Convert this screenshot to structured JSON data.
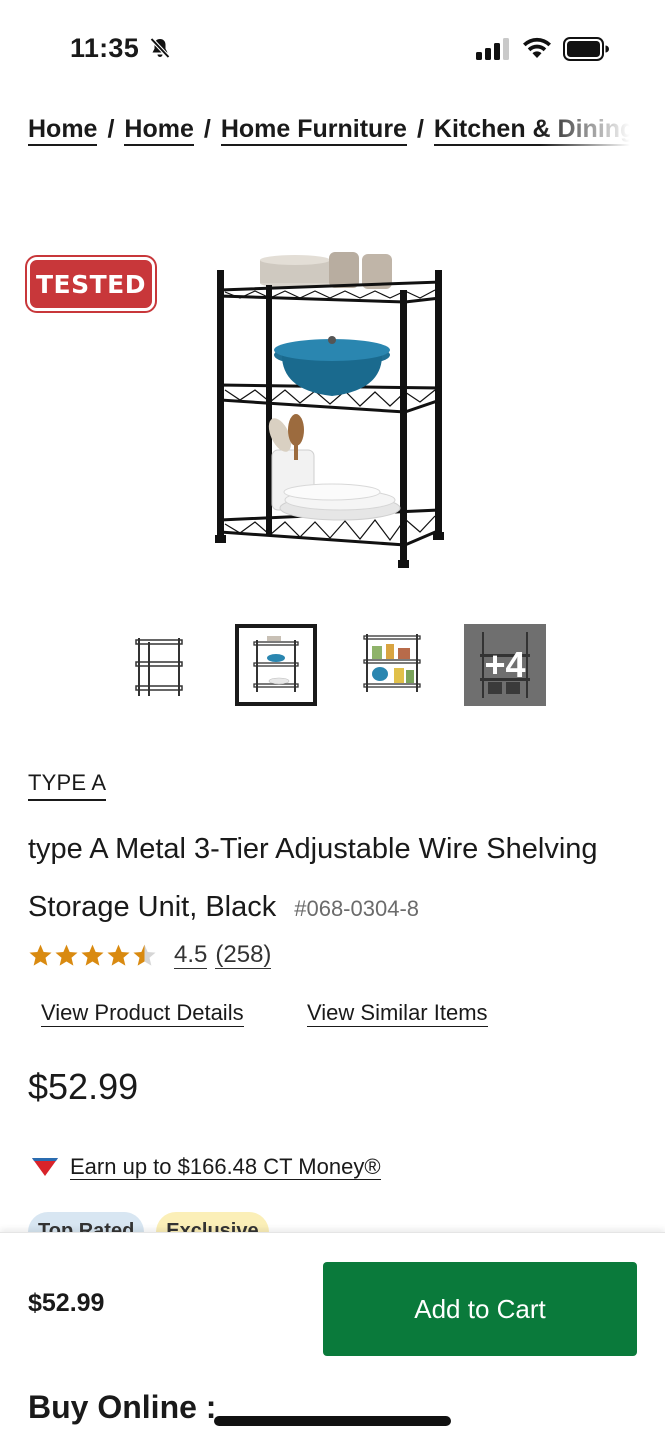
{
  "status_bar": {
    "time": "11:35"
  },
  "breadcrumb": {
    "items": [
      "Home",
      "Home",
      "Home Furniture",
      "Kitchen & Dining"
    ],
    "separator": "/"
  },
  "badge": {
    "tested_label": "TESTED"
  },
  "gallery": {
    "more_label": "+4"
  },
  "product": {
    "brand": "TYPE A",
    "title": "type A Metal 3-Tier Adjustable Wire Shelving Storage Unit, Black",
    "sku": "#068-0304-8",
    "rating_value": "4.5",
    "rating_count": "(258)",
    "rating_stars": 4.5,
    "price": "$52.99"
  },
  "links": {
    "details": "View Product Details",
    "similar": "View Similar Items"
  },
  "ct_money": {
    "text": "Earn up to $166.48 CT Money®"
  },
  "badges": {
    "top_rated": "Top Rated",
    "exclusive": "Exclusive"
  },
  "sticky": {
    "price": "$52.99",
    "add_to_cart": "Add to Cart",
    "buy_online": "Buy Online :"
  },
  "colors": {
    "accent_green": "#0a7a3b",
    "tested_red": "#c8373a",
    "star_orange": "#d98a10"
  }
}
